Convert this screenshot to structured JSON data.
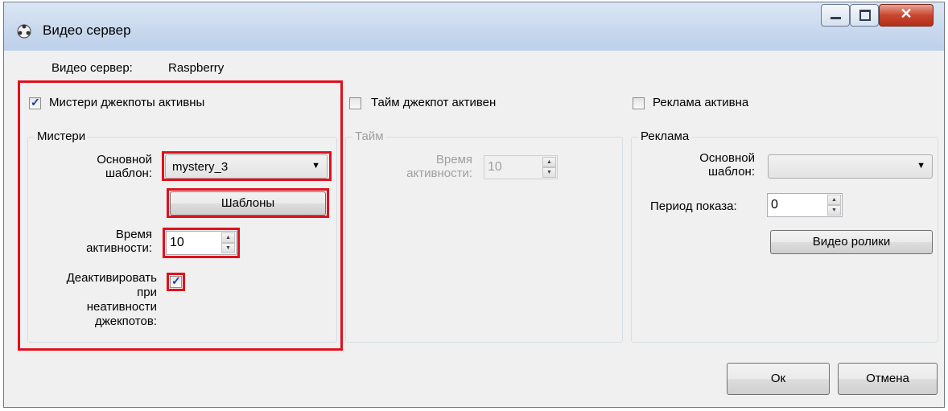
{
  "window": {
    "title": "Видео сервер"
  },
  "header": {
    "label": "Видео сервер:",
    "value": "Raspberry"
  },
  "mystery": {
    "checkbox_label": "Мистери джекпоты активны",
    "checked": true,
    "group_title": "Мистери",
    "template_label_line1": "Основной",
    "template_label_line2": "шаблон:",
    "template_value": "mystery_3",
    "templates_button": "Шаблоны",
    "time_label_line1": "Время",
    "time_label_line2": "активности:",
    "time_value": "10",
    "deactivate_line1": "Деактивировать",
    "deactivate_line2": "при",
    "deactivate_line3": "неативности",
    "deactivate_line4": "джекпотов:",
    "deactivate_checked": true
  },
  "time": {
    "checkbox_label": "Тайм джекпот активен",
    "checked": false,
    "group_title": "Тайм",
    "time_label_line1": "Время",
    "time_label_line2": "активности:",
    "time_value": "10"
  },
  "ads": {
    "checkbox_label": "Реклама активна",
    "checked": false,
    "group_title": "Реклама",
    "template_label_line1": "Основной",
    "template_label_line2": "шаблон:",
    "template_value": "",
    "period_label": "Период показа:",
    "period_value": "0",
    "videos_button": "Видео ролики"
  },
  "footer": {
    "ok": "Ок",
    "cancel": "Отмена"
  }
}
